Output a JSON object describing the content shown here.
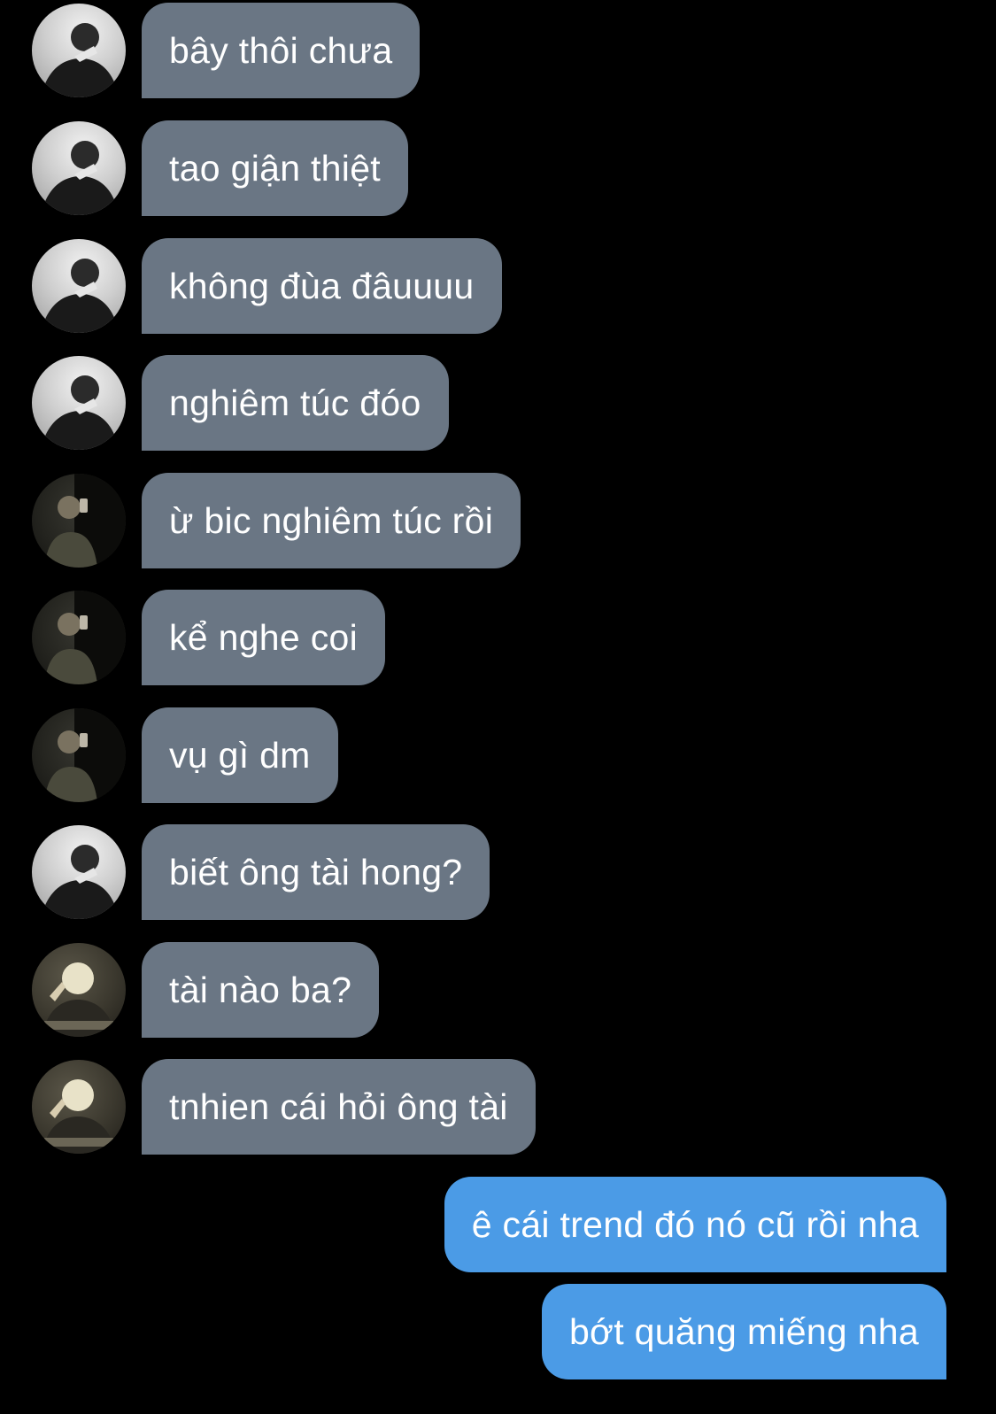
{
  "conversation": {
    "messages": [
      {
        "direction": "incoming",
        "sender": "a",
        "text": "bây thôi chưa"
      },
      {
        "direction": "incoming",
        "sender": "a",
        "text": "tao giận thiệt"
      },
      {
        "direction": "incoming",
        "sender": "a",
        "text": "không đùa đâuuuu"
      },
      {
        "direction": "incoming",
        "sender": "a",
        "text": "nghiêm túc đóo"
      },
      {
        "direction": "incoming",
        "sender": "b",
        "text": "ừ bic nghiêm túc rồi"
      },
      {
        "direction": "incoming",
        "sender": "b",
        "text": "kể nghe coi"
      },
      {
        "direction": "incoming",
        "sender": "b",
        "text": "vụ gì dm"
      },
      {
        "direction": "incoming",
        "sender": "a",
        "text": "biết ông tài hong?"
      },
      {
        "direction": "incoming",
        "sender": "c",
        "text": "tài nào ba?"
      },
      {
        "direction": "incoming",
        "sender": "c",
        "text": "tnhien cái hỏi ông tài"
      },
      {
        "direction": "outgoing",
        "text": "ê cái trend đó nó cũ rồi nha"
      },
      {
        "direction": "outgoing",
        "text": "bớt quăng miếng nha"
      }
    ]
  },
  "colors": {
    "background": "#000000",
    "incoming_bubble": "#6a7684",
    "outgoing_bubble": "#4b9be6",
    "text": "#ffffff"
  },
  "icons": {
    "avatar_a": "avatar-icon",
    "avatar_b": "avatar-icon",
    "avatar_c": "avatar-icon"
  }
}
